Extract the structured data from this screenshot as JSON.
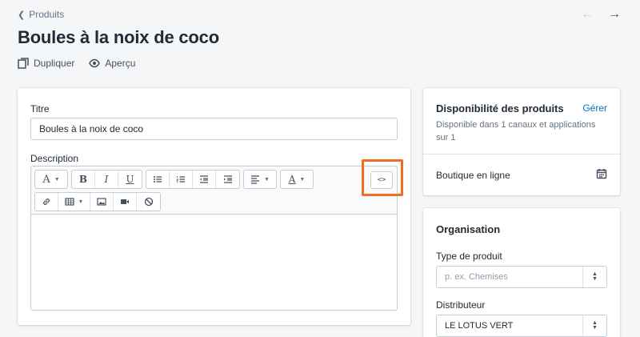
{
  "breadcrumb": {
    "label": "Produits"
  },
  "page": {
    "title": "Boules à la noix de coco"
  },
  "actions": {
    "duplicate": "Dupliquer",
    "preview": "Aperçu"
  },
  "product_form": {
    "title_label": "Titre",
    "title_value": "Boules à la noix de coco",
    "description_label": "Description",
    "toolbar": {
      "font_button": "A",
      "bold": "B",
      "italic": "I",
      "underline": "U",
      "text_color": "A",
      "code_button": "<>"
    }
  },
  "availability": {
    "title": "Disponibilité des produits",
    "manage_link": "Gérer",
    "description": "Disponible dans 1 canaux et applications sur 1",
    "channel": "Boutique en ligne"
  },
  "organization": {
    "title": "Organisation",
    "product_type_label": "Type de produit",
    "product_type_placeholder": "p. ex. Chemises",
    "vendor_label": "Distributeur",
    "vendor_value": "LE LOTUS VERT"
  },
  "colors": {
    "highlight": "#f36c21",
    "link": "#006fbb"
  }
}
